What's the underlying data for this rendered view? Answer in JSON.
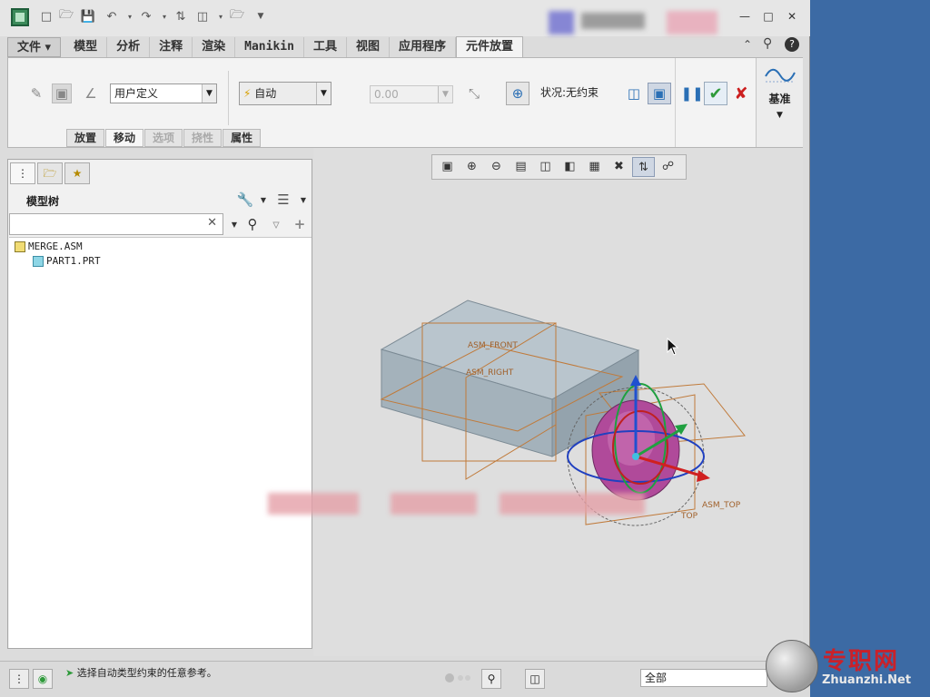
{
  "quick_access": {
    "icons": [
      "new-icon",
      "open-icon",
      "save-icon",
      "undo-icon",
      "redo-icon",
      "regenerate-icon",
      "windows-icon",
      "close-window-icon",
      "customize-icon"
    ]
  },
  "ribbon_tabs": [
    "文件",
    "模型",
    "分析",
    "注释",
    "渲染",
    "Manikin",
    "工具",
    "视图",
    "应用程序",
    "元件放置"
  ],
  "active_tab": "元件放置",
  "placement": {
    "constraint_set": "用户定义",
    "constraint_type": "自动",
    "offset_value": "0.00",
    "status_label": "状况:无约束",
    "datum_button": "基准"
  },
  "subtabs": [
    {
      "label": "放置",
      "enabled": true
    },
    {
      "label": "移动",
      "enabled": true,
      "active": true
    },
    {
      "label": "选项",
      "enabled": false
    },
    {
      "label": "挠性",
      "enabled": false
    },
    {
      "label": "属性",
      "enabled": true
    }
  ],
  "model_tree": {
    "header": "模型树",
    "search_placeholder": "",
    "items": [
      {
        "name": "MERGE.ASM",
        "type": "asm"
      },
      {
        "name": "PART1.PRT",
        "type": "prt"
      }
    ]
  },
  "view_toolbar": [
    "refit-icon",
    "zoom-in-icon",
    "zoom-out-icon",
    "repaint-icon",
    "display-style-icon",
    "saved-views-icon",
    "view-manager-icon",
    "perspective-icon",
    "datum-display-icon",
    "spin-center-icon"
  ],
  "graphics": {
    "labels": {
      "front": "ASM_FRONT",
      "right": "ASM_RIGHT",
      "top": "ASM_TOP",
      "top_short": "TOP"
    }
  },
  "status_bar": {
    "message": "选择自动类型约束的任意参考。",
    "filter": "全部"
  },
  "watermark": {
    "cn": "专职网",
    "en": "Zhuanzhi.Net"
  },
  "colors": {
    "accent_green": "#2e9a3a",
    "cancel_red": "#cc1f1f",
    "datum_orange": "#c07a3a",
    "part_magenta": "#b04a9a"
  }
}
